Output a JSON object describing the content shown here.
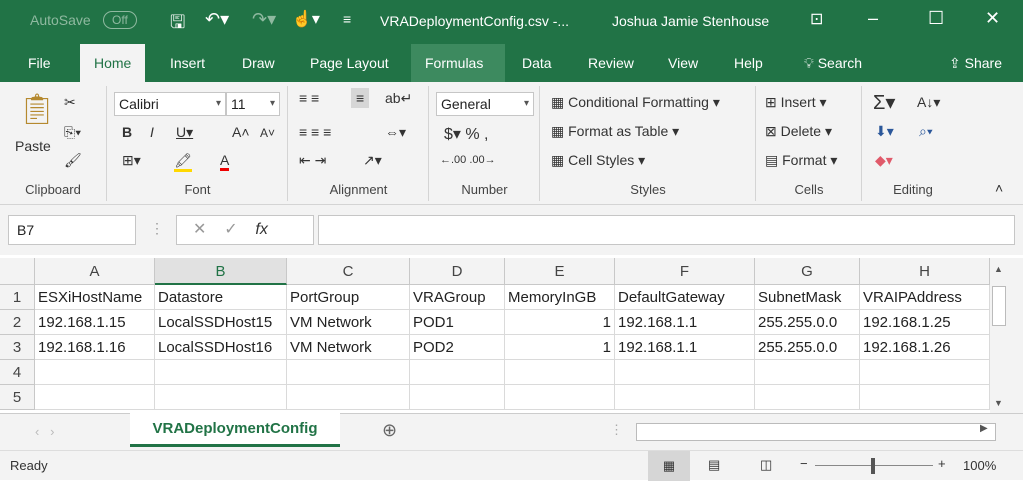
{
  "title": {
    "autosave": "AutoSave",
    "autosave_state": "Off",
    "filename": "VRADeploymentConfig.csv  -...",
    "user": "Joshua Jamie Stenhouse"
  },
  "tabs": [
    "File",
    "Home",
    "Insert",
    "Draw",
    "Page Layout",
    "Formulas",
    "Data",
    "Review",
    "View",
    "Help"
  ],
  "search": "Search",
  "share": "Share",
  "ribbon": {
    "clipboard": {
      "label": "Clipboard",
      "paste": "Paste"
    },
    "font": {
      "label": "Font",
      "name": "Calibri",
      "size": "11"
    },
    "alignment": {
      "label": "Alignment"
    },
    "number": {
      "label": "Number",
      "format": "General"
    },
    "styles": {
      "label": "Styles",
      "conditional": "Conditional Formatting",
      "table": "Format as Table",
      "cell": "Cell Styles"
    },
    "cells": {
      "label": "Cells",
      "insert": "Insert",
      "delete": "Delete",
      "format": "Format"
    },
    "editing": {
      "label": "Editing"
    }
  },
  "namebox": "B7",
  "formula": "",
  "columns": [
    "A",
    "B",
    "C",
    "D",
    "E",
    "F",
    "G",
    "H"
  ],
  "rows": [
    [
      "ESXiHostName",
      "Datastore",
      "PortGroup",
      "VRAGroup",
      "MemoryInGB",
      "DefaultGateway",
      "SubnetMask",
      "VRAIPAddress"
    ],
    [
      "192.168.1.15",
      "LocalSSDHost15",
      "VM Network",
      "POD1",
      "1",
      "192.168.1.1",
      "255.255.0.0",
      "192.168.1.25"
    ],
    [
      "192.168.1.16",
      "LocalSSDHost16",
      "VM Network",
      "POD2",
      "1",
      "192.168.1.1",
      "255.255.0.0",
      "192.168.1.26"
    ],
    [
      "",
      "",
      "",
      "",
      "",
      "",
      "",
      ""
    ],
    [
      "",
      "",
      "",
      "",
      "",
      "",
      "",
      ""
    ]
  ],
  "row_numbers": [
    "1",
    "2",
    "3",
    "4",
    "5"
  ],
  "sheet_tab": "VRADeploymentConfig",
  "status": "Ready",
  "zoom": "100%"
}
